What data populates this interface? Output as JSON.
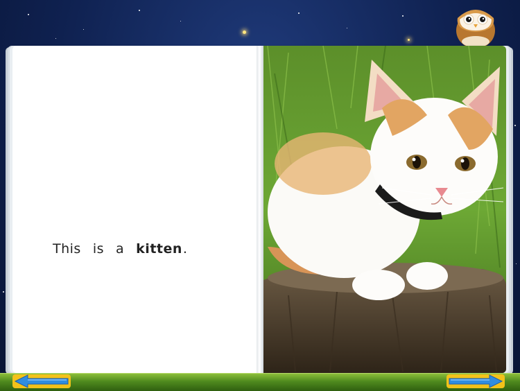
{
  "book": {
    "sentence": {
      "word1": "This",
      "word2": "is",
      "word3": "a",
      "highlight": "kitten",
      "punct": "."
    },
    "photo_subject": "kitten-on-stump"
  },
  "navigation": {
    "prev_icon": "arrow-left-icon",
    "next_icon": "arrow-right-icon"
  },
  "mascot": {
    "icon": "owl-icon"
  },
  "colors": {
    "sky": "#0f2150",
    "bar_green": "#4f8a1e",
    "arrow_blue": "#2f8de0",
    "arrow_gold": "#f2c21a"
  }
}
